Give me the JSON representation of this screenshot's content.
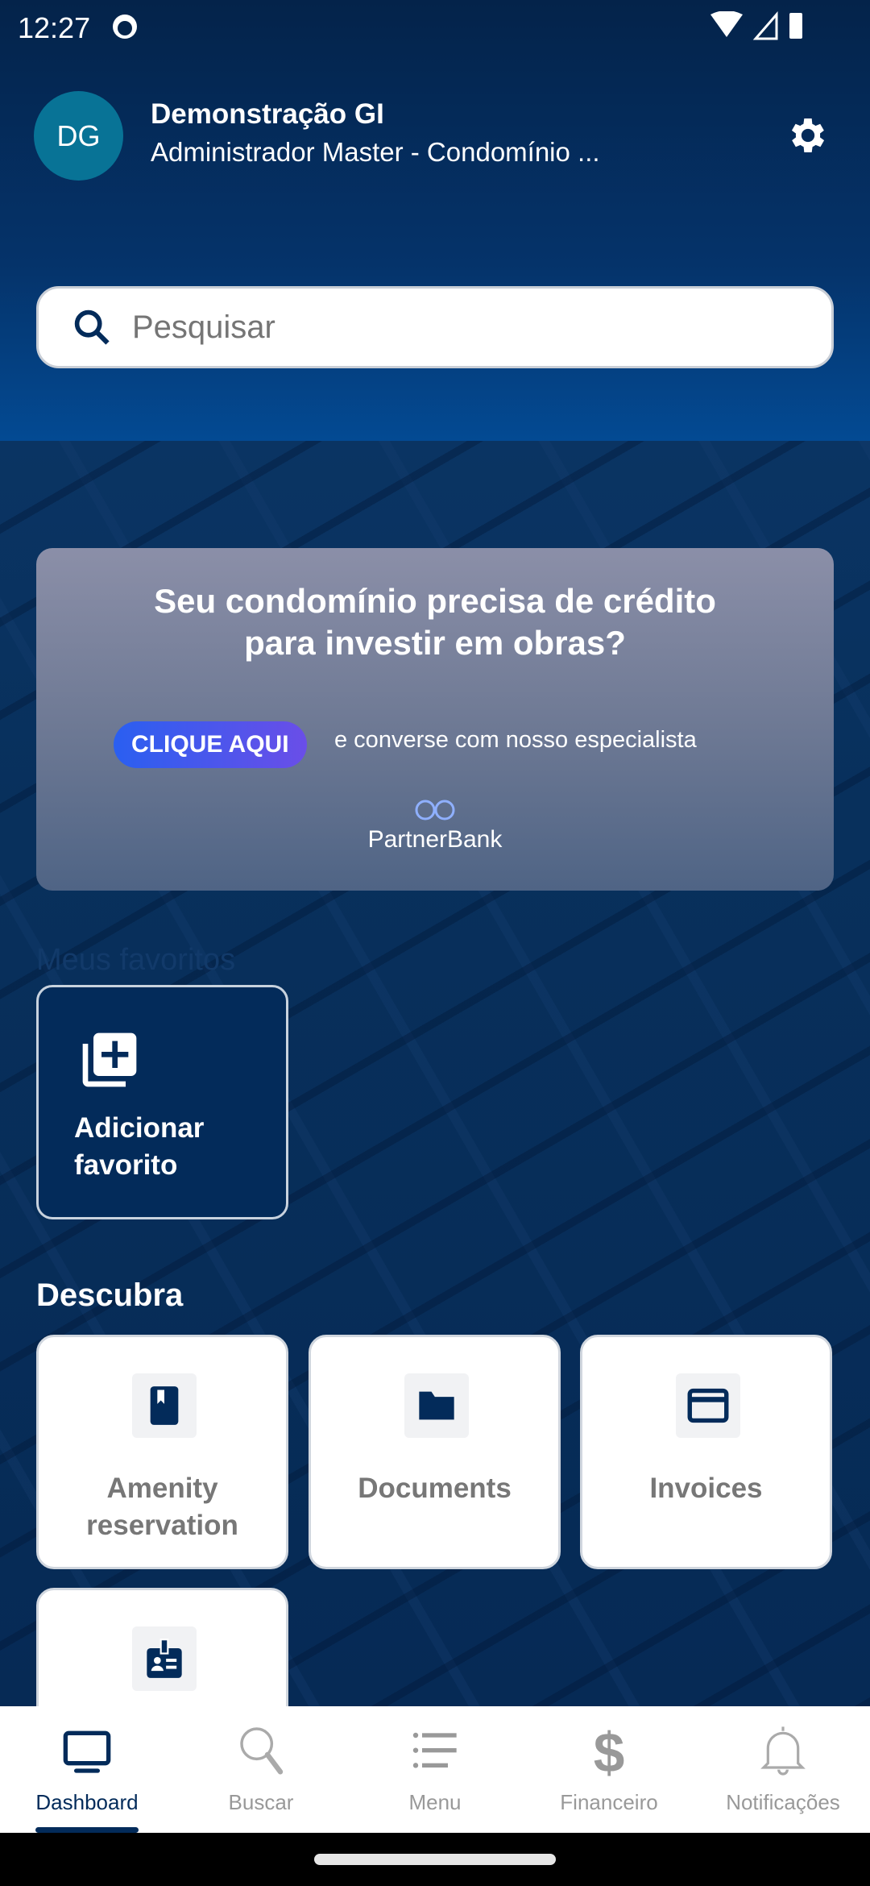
{
  "status_bar": {
    "time": "12:27"
  },
  "profile": {
    "initials": "DG",
    "name": "Demonstração GI",
    "role": "Administrador Master - Condomínio ..."
  },
  "search": {
    "placeholder": "Pesquisar",
    "value": ""
  },
  "banner": {
    "headline_1": "Seu condomínio precisa de crédito",
    "headline_2": "para investir em obras?",
    "cta": "CLIQUE AQUI",
    "cta_text": "e converse com nosso especialista",
    "brand": "PartnerBank"
  },
  "favorites": {
    "title": "Meus favoritos",
    "add_label_1": "Adicionar",
    "add_label_2": "favorito"
  },
  "discover": {
    "title": "Descubra",
    "tiles": [
      {
        "line1": "Amenity",
        "line2": "reservation",
        "icon": "bookmark-book-icon"
      },
      {
        "line1": "Documents",
        "line2": "",
        "icon": "folder-icon"
      },
      {
        "line1": "Invoices",
        "line2": "",
        "icon": "credit-card-icon"
      },
      {
        "line1": "",
        "line2": "",
        "icon": "badge-id-icon"
      }
    ]
  },
  "bottom_nav": {
    "items": [
      {
        "label": "Dashboard",
        "icon": "monitor-icon",
        "active": true
      },
      {
        "label": "Buscar",
        "icon": "search-icon"
      },
      {
        "label": "Menu",
        "icon": "list-icon"
      },
      {
        "label": "Financeiro",
        "icon": "dollar-icon"
      },
      {
        "label": "Notificações",
        "icon": "bell-icon"
      }
    ]
  },
  "colors": {
    "primary": "#032b5a",
    "avatar": "#087396",
    "inactive": "#999999"
  }
}
